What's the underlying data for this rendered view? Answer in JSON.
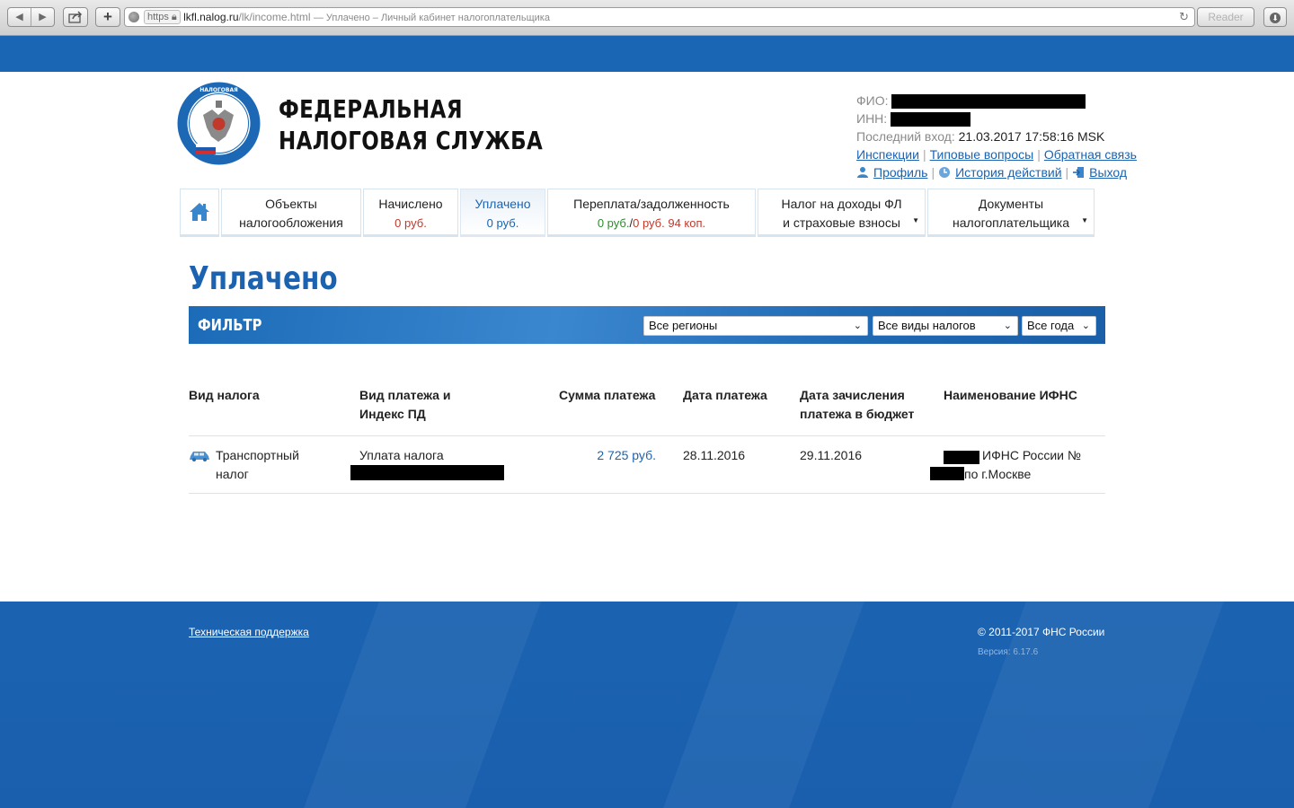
{
  "browser": {
    "scheme": "https",
    "host": "lkfl.nalog.ru",
    "path": "/lk/income.html",
    "title": "— Уплачено – Личный кабинет налогоплательщика",
    "reader_label": "Reader"
  },
  "header": {
    "org_line1": "ФЕДЕРАЛЬНАЯ",
    "org_line2": "НАЛОГОВАЯ СЛУЖБА",
    "fio_label": "ФИО:",
    "inn_label": "ИНН:",
    "last_login_label": "Последний вход:",
    "last_login_value": "21.03.2017 17:58:16 MSK",
    "links": {
      "inspections": "Инспекции",
      "faq": "Типовые вопросы",
      "feedback": "Обратная связь",
      "profile": "Профиль",
      "history": "История действий",
      "logout": "Выход"
    }
  },
  "tabs": [
    {
      "label1": "Объекты",
      "label2": "налогообложения"
    },
    {
      "label": "Начислено",
      "sub": "0 руб."
    },
    {
      "label": "Уплачено",
      "sub": "0 руб."
    },
    {
      "label": "Переплата/задолженность",
      "sub_green": "0 руб.",
      "sub_sep": "/",
      "sub_red": "0 руб. 94 коп."
    },
    {
      "label1": "Налог на доходы ФЛ",
      "label2": "и страховые взносы"
    },
    {
      "label1": "Документы",
      "label2": "налогоплательщика"
    }
  ],
  "page_title": "Уплачено",
  "filter": {
    "label": "ФИЛЬТР",
    "region": "Все регионы",
    "tax_type": "Все виды налогов",
    "year": "Все года"
  },
  "table": {
    "headers": {
      "tax_type": "Вид налога",
      "payment_type_1": "Вид платежа и",
      "payment_type_2": "Индекс ПД",
      "amount": "Сумма платежа",
      "pay_date": "Дата платежа",
      "credit_date_1": "Дата зачисления",
      "credit_date_2": "платежа в бюджет",
      "ifns": "Наименование ИФНС"
    },
    "rows": [
      {
        "tax_1": "Транспортный",
        "tax_2": "налог",
        "payment": "Уплата налога",
        "amount": "2 725 руб.",
        "pay_date": "28.11.2016",
        "credit_date": "29.11.2016",
        "ifns_1": "ИФНС России №",
        "ifns_2": "по г.Москве"
      }
    ]
  },
  "footer": {
    "support": "Техническая поддержка",
    "copyright": "© 2011-2017 ФНС России",
    "version": "Версия: 6.17.6"
  }
}
